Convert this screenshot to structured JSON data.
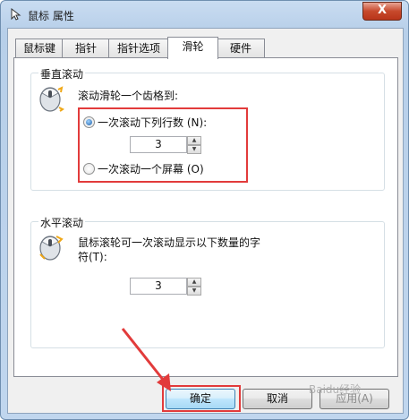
{
  "window": {
    "title": "鼠标 属性",
    "close_label": "X"
  },
  "tabs": [
    {
      "label": "鼠标键",
      "active": false
    },
    {
      "label": "指针",
      "active": false
    },
    {
      "label": "指针选项",
      "active": false
    },
    {
      "label": "滑轮",
      "active": true
    },
    {
      "label": "硬件",
      "active": false
    }
  ],
  "vertical_scroll": {
    "title": "垂直滚动",
    "description": "滚动滑轮一个齿格到:",
    "option_lines": {
      "label": "一次滚动下列行数 (N):",
      "selected": true
    },
    "lines_value": "3",
    "option_screen": {
      "label": "一次滚动一个屏幕 (O)",
      "selected": false
    }
  },
  "horizontal_scroll": {
    "title": "水平滚动",
    "description_line1": "鼠标滚轮可一次滚动显示以下数量的字",
    "description_line2": "符(T):",
    "chars_value": "3"
  },
  "buttons": {
    "ok": "确定",
    "cancel": "取消",
    "apply": "应用(A)"
  },
  "watermark": "Baidu经验",
  "colors": {
    "highlight": "#e23b3b",
    "title_bar": "#bcd2ea"
  }
}
